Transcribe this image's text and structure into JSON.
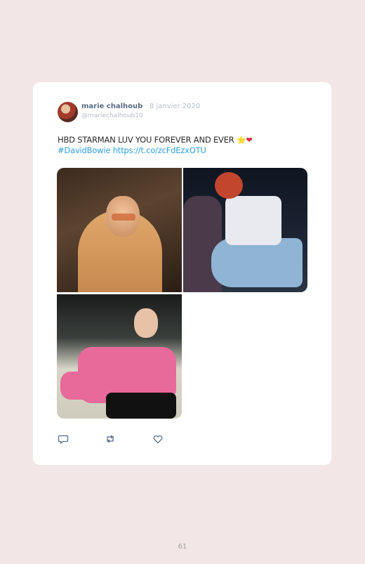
{
  "tweet": {
    "user_name": "marie chalhoub",
    "separator": "·",
    "date": "8 janvier 2020",
    "handle": "@mariechalhoub10",
    "text": "HBD STARMAN LUV YOU FOREVER AND EVER",
    "emoji_star": "⭐",
    "emoji_heart": "❤",
    "hashtag": "#DavidBowie",
    "link": "https://t.co/zcFdEzxOTU",
    "photos": [
      "photo-1",
      "photo-2",
      "photo-3"
    ],
    "actions": {
      "reply_icon": "reply-icon",
      "retweet_icon": "retweet-icon",
      "like_icon": "heart-icon"
    }
  },
  "page": {
    "number": "61"
  },
  "colors": {
    "background": "#f3e6e6",
    "card": "#ffffff",
    "link": "#2f9fe0",
    "name": "#5b6b86",
    "muted": "#b7bcc8"
  }
}
